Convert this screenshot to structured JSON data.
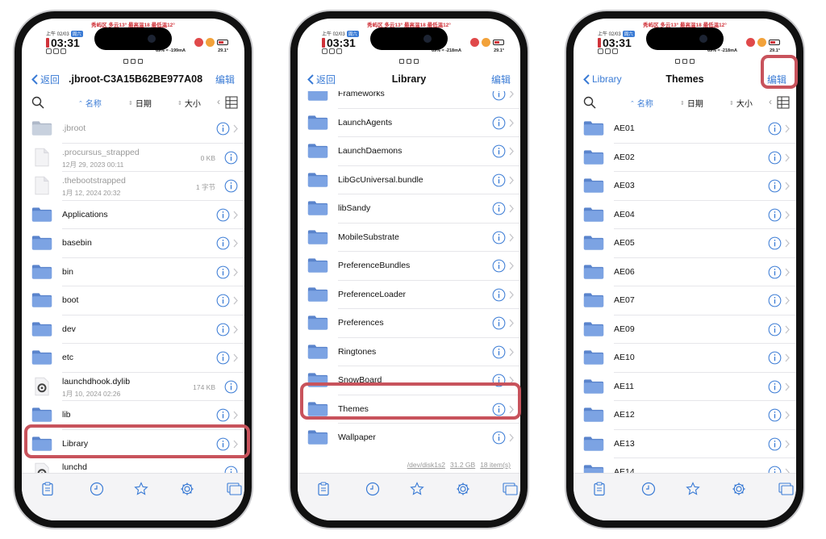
{
  "status": {
    "weather": "秀屿区 多云13° 最高温18 最低温12°",
    "date": "上午 02/03",
    "date_tag": "周六",
    "time": "03:31",
    "left_stats": "69% ≈ -199mA",
    "middle_stats": "69% ≈ -218mA",
    "right_stats": "69% ≈ -218mA",
    "temp": "29.1°"
  },
  "colors": {
    "accent": "#3a7bd5",
    "highlight": "#c8535c",
    "folder": "#6b93d6"
  },
  "screens": [
    {
      "nav": {
        "back_label": "返回",
        "title": "jbroot-C3A15B62BE977A08",
        "title_prefix": ".",
        "edit_label": "编辑"
      },
      "sort": {
        "name": "名称",
        "date": "日期",
        "size": "大小"
      },
      "rows": [
        {
          "name": ".jbroot",
          "icon": "folder-dim-icon"
        },
        {
          "name": ".procursus_strapped",
          "sub": "12月 29, 2023 00:11",
          "size": "0 KB",
          "icon": "file-icon"
        },
        {
          "name": ".thebootstrapped",
          "sub": "1月 12, 2024 20:32",
          "size": "1 字节",
          "icon": "file-icon"
        },
        {
          "name": "Applications",
          "icon": "folder-icon"
        },
        {
          "name": "basebin",
          "icon": "folder-icon"
        },
        {
          "name": "bin",
          "icon": "folder-icon"
        },
        {
          "name": "boot",
          "icon": "folder-icon"
        },
        {
          "name": "dev",
          "icon": "folder-link-icon"
        },
        {
          "name": "etc",
          "icon": "folder-icon"
        },
        {
          "name": "launchdhook.dylib",
          "sub": "1月 10, 2024 02:26",
          "size": "174 KB",
          "icon": "gear-file-icon"
        },
        {
          "name": "lib",
          "icon": "folder-icon"
        },
        {
          "name": "Library",
          "icon": "folder-icon"
        },
        {
          "name": "lunchd",
          "icon": "gear-file-icon"
        }
      ]
    },
    {
      "nav": {
        "back_label": "返回",
        "title": "Library",
        "edit_label": "编辑"
      },
      "rows": [
        {
          "name": "Frameworks",
          "icon": "folder-icon"
        },
        {
          "name": "LaunchAgents",
          "icon": "folder-icon"
        },
        {
          "name": "LaunchDaemons",
          "icon": "folder-icon"
        },
        {
          "name": "LibGcUniversal.bundle",
          "icon": "folder-icon"
        },
        {
          "name": "libSandy",
          "icon": "folder-icon"
        },
        {
          "name": "MobileSubstrate",
          "icon": "folder-icon"
        },
        {
          "name": "PreferenceBundles",
          "icon": "folder-icon"
        },
        {
          "name": "PreferenceLoader",
          "icon": "folder-icon"
        },
        {
          "name": "Preferences",
          "icon": "folder-icon"
        },
        {
          "name": "Ringtones",
          "icon": "folder-icon"
        },
        {
          "name": "SnowBoard",
          "icon": "folder-icon"
        },
        {
          "name": "Themes",
          "icon": "folder-icon"
        },
        {
          "name": "Wallpaper",
          "icon": "folder-icon"
        }
      ],
      "footer": {
        "disk": "/dev/disk1s2",
        "free": "31.2 GB",
        "count": "18 item(s)"
      }
    },
    {
      "nav": {
        "back_label": "Library",
        "title": "Themes",
        "edit_label": "编辑"
      },
      "sort": {
        "name": "名称",
        "date": "日期",
        "size": "大小"
      },
      "rows": [
        {
          "name": "AE01",
          "icon": "folder-icon"
        },
        {
          "name": "AE02",
          "icon": "folder-icon"
        },
        {
          "name": "AE03",
          "icon": "folder-icon"
        },
        {
          "name": "AE04",
          "icon": "folder-icon"
        },
        {
          "name": "AE05",
          "icon": "folder-icon"
        },
        {
          "name": "AE06",
          "icon": "folder-icon"
        },
        {
          "name": "AE07",
          "icon": "folder-icon"
        },
        {
          "name": "AE09",
          "icon": "folder-icon"
        },
        {
          "name": "AE10",
          "icon": "folder-icon"
        },
        {
          "name": "AE11",
          "icon": "folder-icon"
        },
        {
          "name": "AE12",
          "icon": "folder-icon"
        },
        {
          "name": "AE13",
          "icon": "folder-icon"
        },
        {
          "name": "AE14",
          "icon": "folder-icon"
        }
      ]
    }
  ]
}
